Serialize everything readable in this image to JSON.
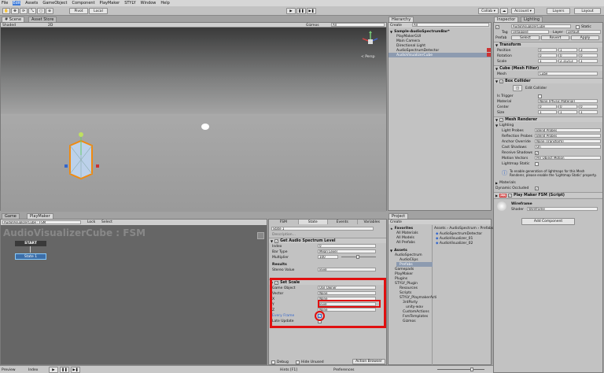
{
  "menu": [
    "File",
    "Edit",
    "Assets",
    "GameObject",
    "Component",
    "PlayMaker",
    "STYLY",
    "Window",
    "Help"
  ],
  "toolbar": {
    "pivot": "Pivot",
    "local": "Local",
    "collab": "Collab ▾",
    "account": "Account ▾",
    "layers": "Layers",
    "layout": "Layout"
  },
  "scene": {
    "tab_scene": "Scene",
    "tab_asset_store": "Asset Store",
    "shading": "Shaded",
    "twod": "2D",
    "gizmos": "Gizmos",
    "search": "All",
    "persp": "< Persp"
  },
  "hierarchy": {
    "tab": "Hierarchy",
    "create": "Create",
    "search": "All",
    "root": "Sample-AudioSpectrumBar*",
    "items": [
      "PlayMakerGUI",
      "Main Camera",
      "Directional Light",
      "AudioSpectrumDetector",
      "AudioVisualizerCube"
    ]
  },
  "inspector": {
    "tab_inspector": "Inspector",
    "tab_lighting": "Lighting",
    "object_name": "AudioVisualizerCube",
    "static": "Static",
    "tag_label": "Tag",
    "tag_value": "Untagged",
    "layer_label": "Layer",
    "layer_value": "Default",
    "prefab_label": "Prefab",
    "prefab_select": "Select",
    "prefab_revert": "Revert",
    "prefab_apply": "Apply",
    "transform": {
      "title": "Transform",
      "rows": [
        {
          "label": "Position",
          "x": "0",
          "y": "1",
          "z": "3"
        },
        {
          "label": "Rotation",
          "x": "0",
          "y": "0",
          "z": "0"
        },
        {
          "label": "Scale",
          "x": "1",
          "y": "2.11213",
          "z": "1"
        }
      ]
    },
    "mesh_filter": {
      "title": "Cube (Mesh Filter)",
      "mesh_label": "Mesh",
      "mesh_value": "Cube"
    },
    "box_collider": {
      "title": "Box Collider",
      "edit_label": "Edit Collider",
      "is_trigger": "Is Trigger",
      "material_label": "Material",
      "material_value": "None (Physic Material)",
      "center_label": "Center",
      "center": {
        "x": "0",
        "y": "0",
        "z": "0"
      },
      "size_label": "Size",
      "size": {
        "x": "1",
        "y": "1",
        "z": "1"
      }
    },
    "mesh_renderer": {
      "title": "Mesh Renderer",
      "lighting": "Lighting",
      "rows": [
        {
          "label": "Light Probes",
          "value": "Blend Probes"
        },
        {
          "label": "Reflection Probes",
          "value": "Blend Probes"
        },
        {
          "label": "Anchor Override",
          "value": "None (Transform)"
        },
        {
          "label": "Cast Shadows",
          "value": "On"
        },
        {
          "label": "Receive Shadows",
          "value": ""
        },
        {
          "label": "Motion Vectors",
          "value": "Per Object Motion"
        },
        {
          "label": "Lightmap Static",
          "value": ""
        }
      ],
      "info": "To enable generation of lightmaps for this Mesh Renderer, please enable the 'Lightmap Static' property.",
      "materials": "Materials",
      "dynamic_occluded": "Dynamic Occluded"
    },
    "fsm": {
      "title": "Play Maker FSM (Script)"
    },
    "material": {
      "name": "Wireframe",
      "shader_label": "Shader",
      "shader_value": "Wireframe"
    },
    "add_component": "Add Component"
  },
  "bottom": {
    "tab_game": "Game",
    "tab_playmaker": "PlayMaker",
    "fsm_selector": "AudioVisualizerCube : FSM",
    "lock": "Lock",
    "select": "Select",
    "graph_title": "AudioVisualizerCube : FSM",
    "start": "START",
    "state": "State 1",
    "footer_tabs": [
      "Hints [F1]",
      "Preferences"
    ],
    "preview": "Preview",
    "index": "Index"
  },
  "state_panel": {
    "tabs": [
      "FSM",
      "State",
      "Events",
      "Variables"
    ],
    "state_name": "State 1",
    "description": "Description...",
    "action1": {
      "title": "Get Audio Spectrum Level",
      "rows": [
        {
          "label": "Index",
          "value": "0"
        },
        {
          "label": "Bar Type",
          "value": "Mean Level"
        },
        {
          "label": "Multiplier",
          "value": "100"
        }
      ],
      "results": "Results",
      "stereo_label": "Stereo Value",
      "stereo_value": "level"
    },
    "action2": {
      "title": "Set Scale",
      "rows": [
        {
          "label": "Game Object",
          "value": "Use Owner"
        },
        {
          "label": "Vector",
          "value": "None"
        },
        {
          "label": "X",
          "value": "None"
        },
        {
          "label": "Y",
          "value": "level"
        },
        {
          "label": "Z",
          "value": "None"
        },
        {
          "label": "Every Frame",
          "value": ""
        },
        {
          "label": "Late Update",
          "value": ""
        }
      ]
    },
    "debug": "Debug",
    "hide_unused": "Hide Unused",
    "action_browser": "Action Browser"
  },
  "project": {
    "tab": "Project",
    "create": "Create",
    "breadcrumb": "Assets › AudioSpectrum › Prefabs",
    "favorites": "Favorites",
    "fav_items": [
      "All Materials",
      "All Models",
      "All Prefabs"
    ],
    "assets": "Assets",
    "tree": [
      "AudioSpectrum",
      "AudioClips",
      "Prefabs",
      "Gamepads",
      "PlayMaker",
      "Plugins",
      "STYLY_Plugin",
      "Resources",
      "Scripts",
      "STYLY_PlaymakerActi",
      "3rdParty",
      "unity-wav",
      "CustomActions",
      "FsmTemplates",
      "Gizmos"
    ],
    "files": [
      "AudioSpectrumDetector",
      "AudioVisualizer_01",
      "AudioVisualizer_02"
    ]
  },
  "colors": {
    "highlight": "#e01010",
    "selection": "#3d7ad8",
    "state_blue": "#3c6ea8"
  }
}
